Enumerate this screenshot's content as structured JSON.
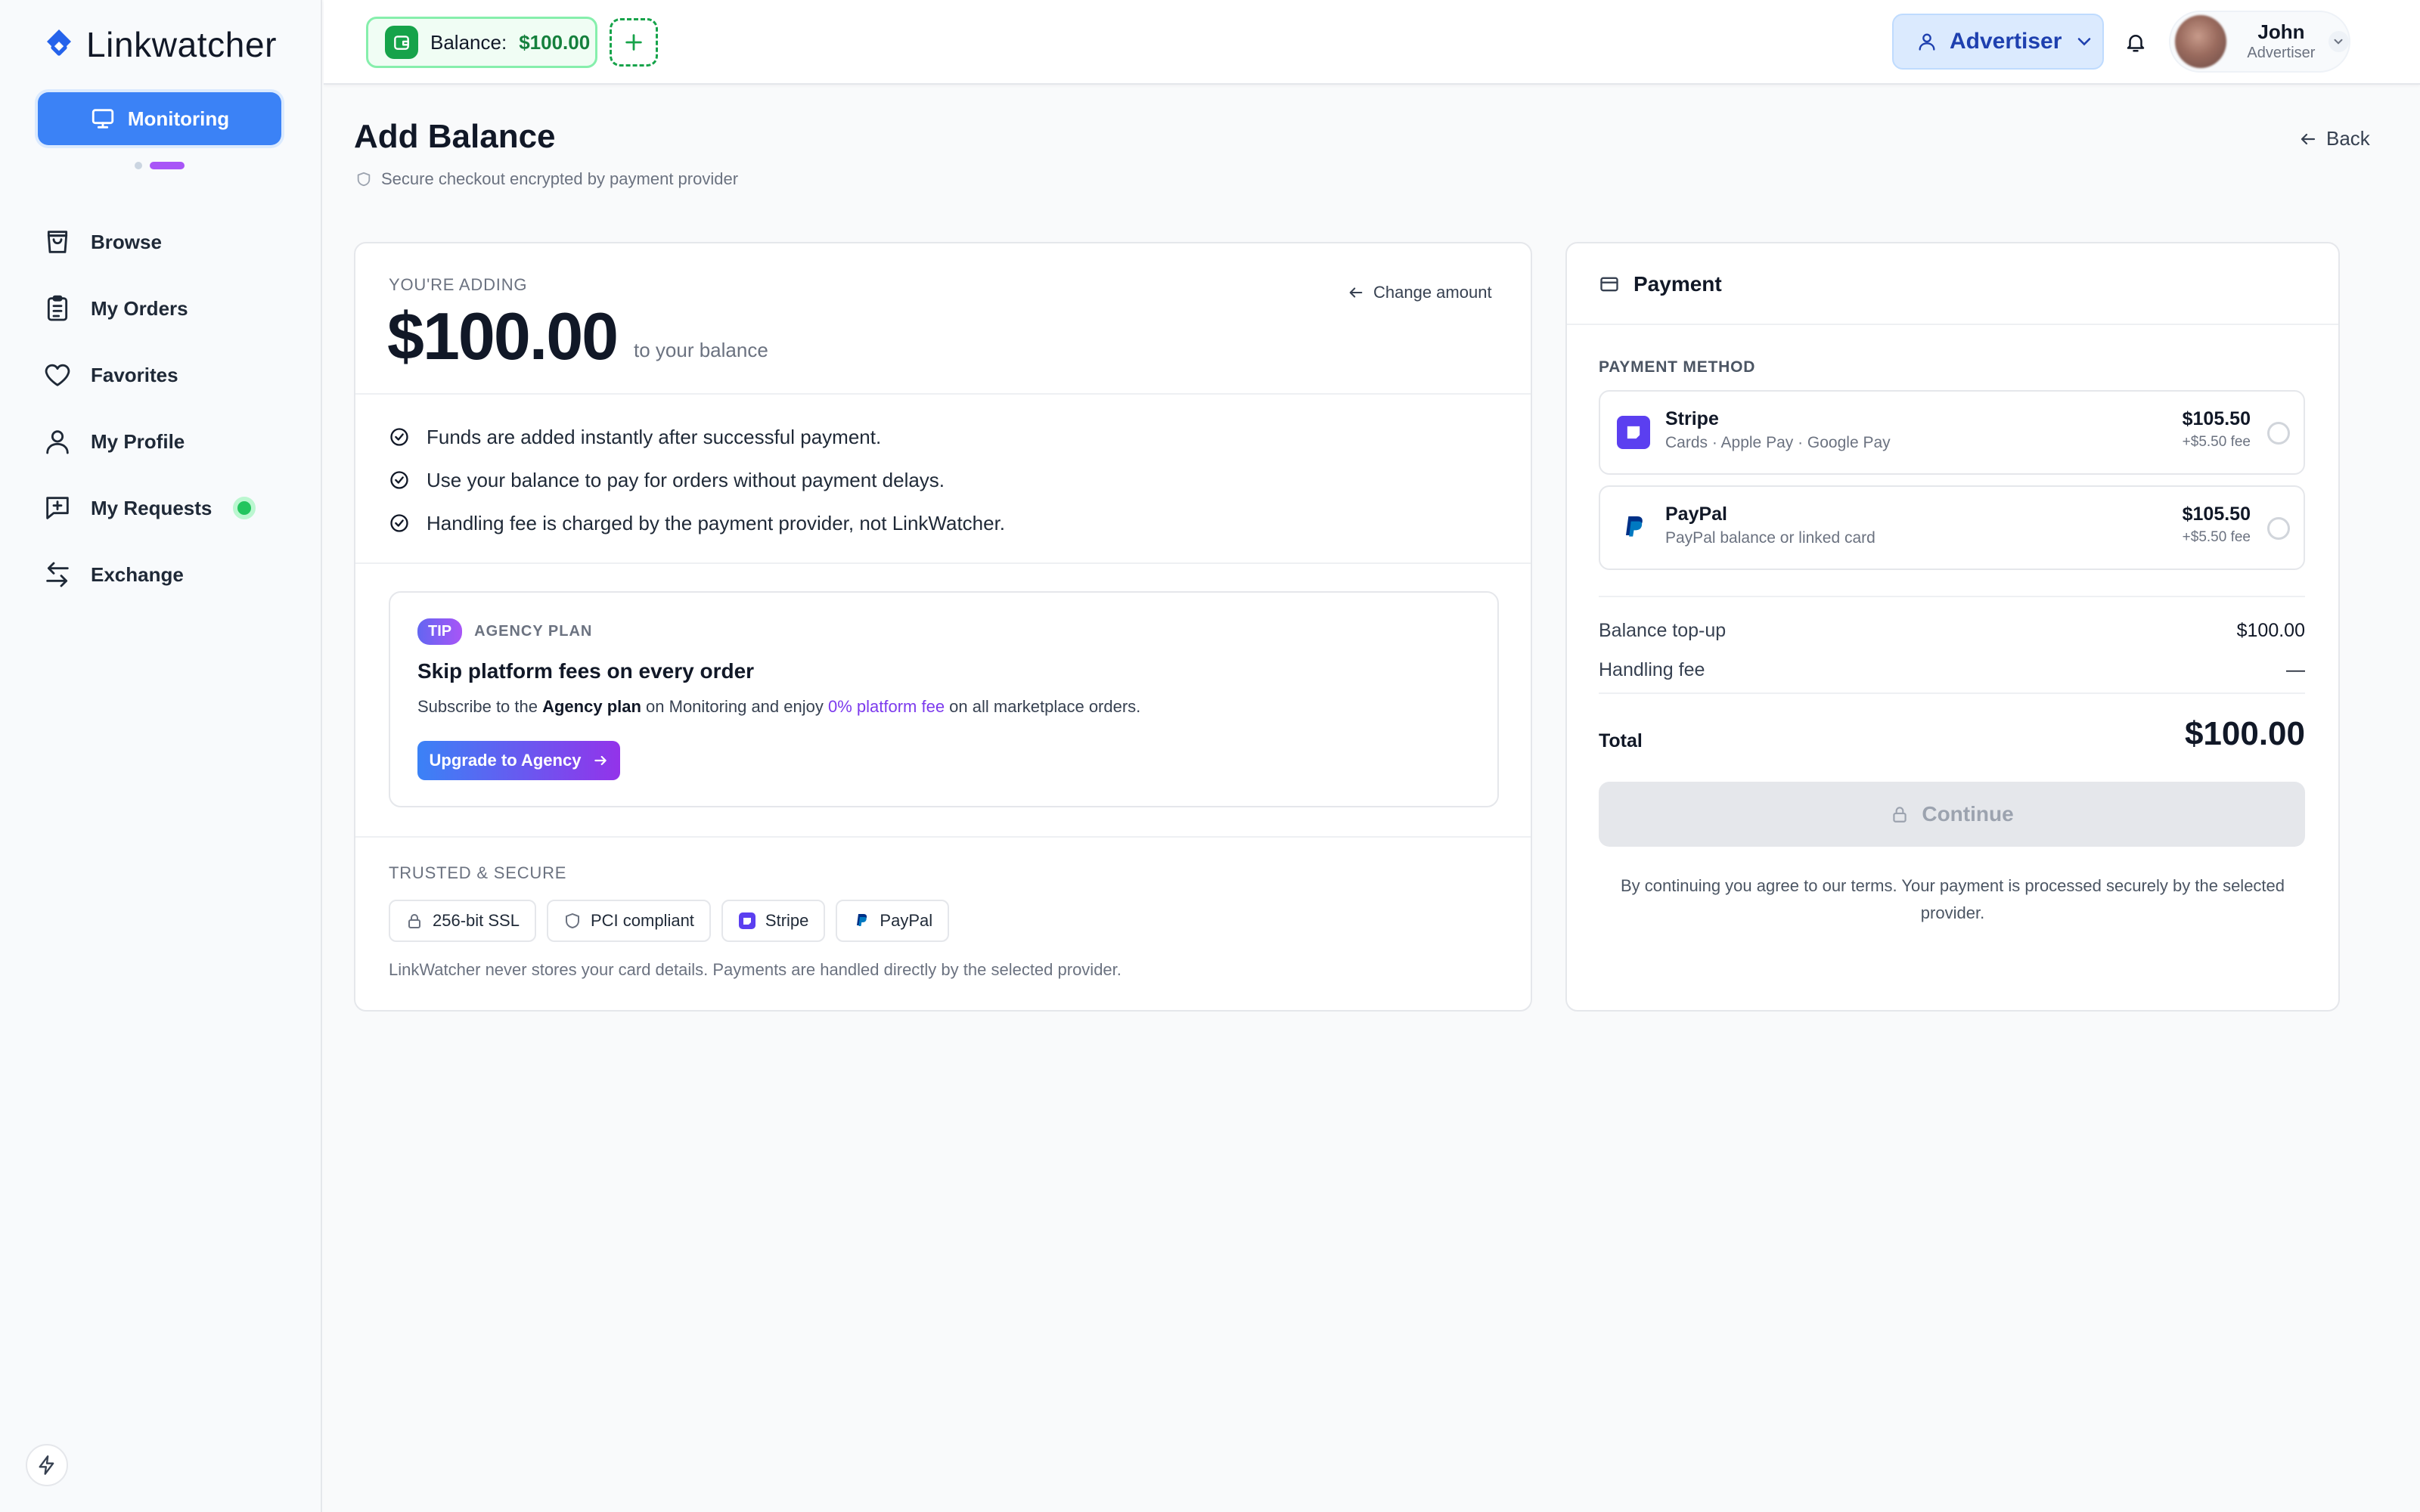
{
  "app": {
    "name": "Linkwatcher"
  },
  "sidebar": {
    "primary_button": "Monitoring",
    "items": [
      {
        "label": "Browse",
        "icon": "shopping-bag-icon"
      },
      {
        "label": "My Orders",
        "icon": "clipboard-list-icon"
      },
      {
        "label": "Favorites",
        "icon": "heart-icon"
      },
      {
        "label": "My Profile",
        "icon": "user-icon"
      },
      {
        "label": "My Requests",
        "icon": "message-plus-icon",
        "status": "online"
      },
      {
        "label": "Exchange",
        "icon": "arrows-exchange-icon"
      }
    ]
  },
  "topbar": {
    "balance_label": "Balance:",
    "balance_value": "$100.00",
    "role": "Advertiser",
    "user_name": "John",
    "user_role": "Advertiser"
  },
  "page": {
    "title": "Add Balance",
    "secure_note": "Secure checkout encrypted by payment provider",
    "back_label": "Back"
  },
  "adding": {
    "label": "YOU'RE ADDING",
    "amount": "$100.00",
    "suffix": "to your balance",
    "change_label": "Change amount"
  },
  "benefits": [
    "Funds are added instantly after successful payment.",
    "Use your balance to pay for orders without payment delays.",
    "Handling fee is charged by the payment provider, not LinkWatcher."
  ],
  "tip": {
    "badge": "TIP",
    "plan": "AGENCY PLAN",
    "title": "Skip platform fees on every order",
    "text_1": "Subscribe to the ",
    "text_bold": "Agency plan",
    "text_2": " on Monitoring and enjoy ",
    "text_link": "0% platform fee",
    "text_3": " on all marketplace orders.",
    "button": "Upgrade to Agency"
  },
  "trusted": {
    "label": "TRUSTED & SECURE",
    "chips": [
      "256-bit SSL",
      "PCI compliant",
      "Stripe",
      "PayPal"
    ],
    "note": "LinkWatcher never stores your card details. Payments are handled directly by the selected provider."
  },
  "payment": {
    "title": "Payment",
    "method_label": "PAYMENT METHOD",
    "methods": [
      {
        "name": "Stripe",
        "desc": "Cards · Apple Pay · Google Pay",
        "price": "$105.50",
        "fee": "+$5.50 fee",
        "selected": false
      },
      {
        "name": "PayPal",
        "desc": "PayPal balance or linked card",
        "price": "$105.50",
        "fee": "+$5.50 fee",
        "selected": false
      }
    ],
    "summary": {
      "topup_label": "Balance top-up",
      "topup_value": "$100.00",
      "fee_label": "Handling fee",
      "fee_value": "—",
      "total_label": "Total",
      "total_value": "$100.00"
    },
    "continue_label": "Continue",
    "terms": "By continuing you agree to our terms. Your payment is processed securely by the selected provider."
  },
  "colors": {
    "primary": "#3b82f6",
    "accent_purple": "#9333ea",
    "balance_green": "#16a34a",
    "status_green": "#22c55e"
  }
}
